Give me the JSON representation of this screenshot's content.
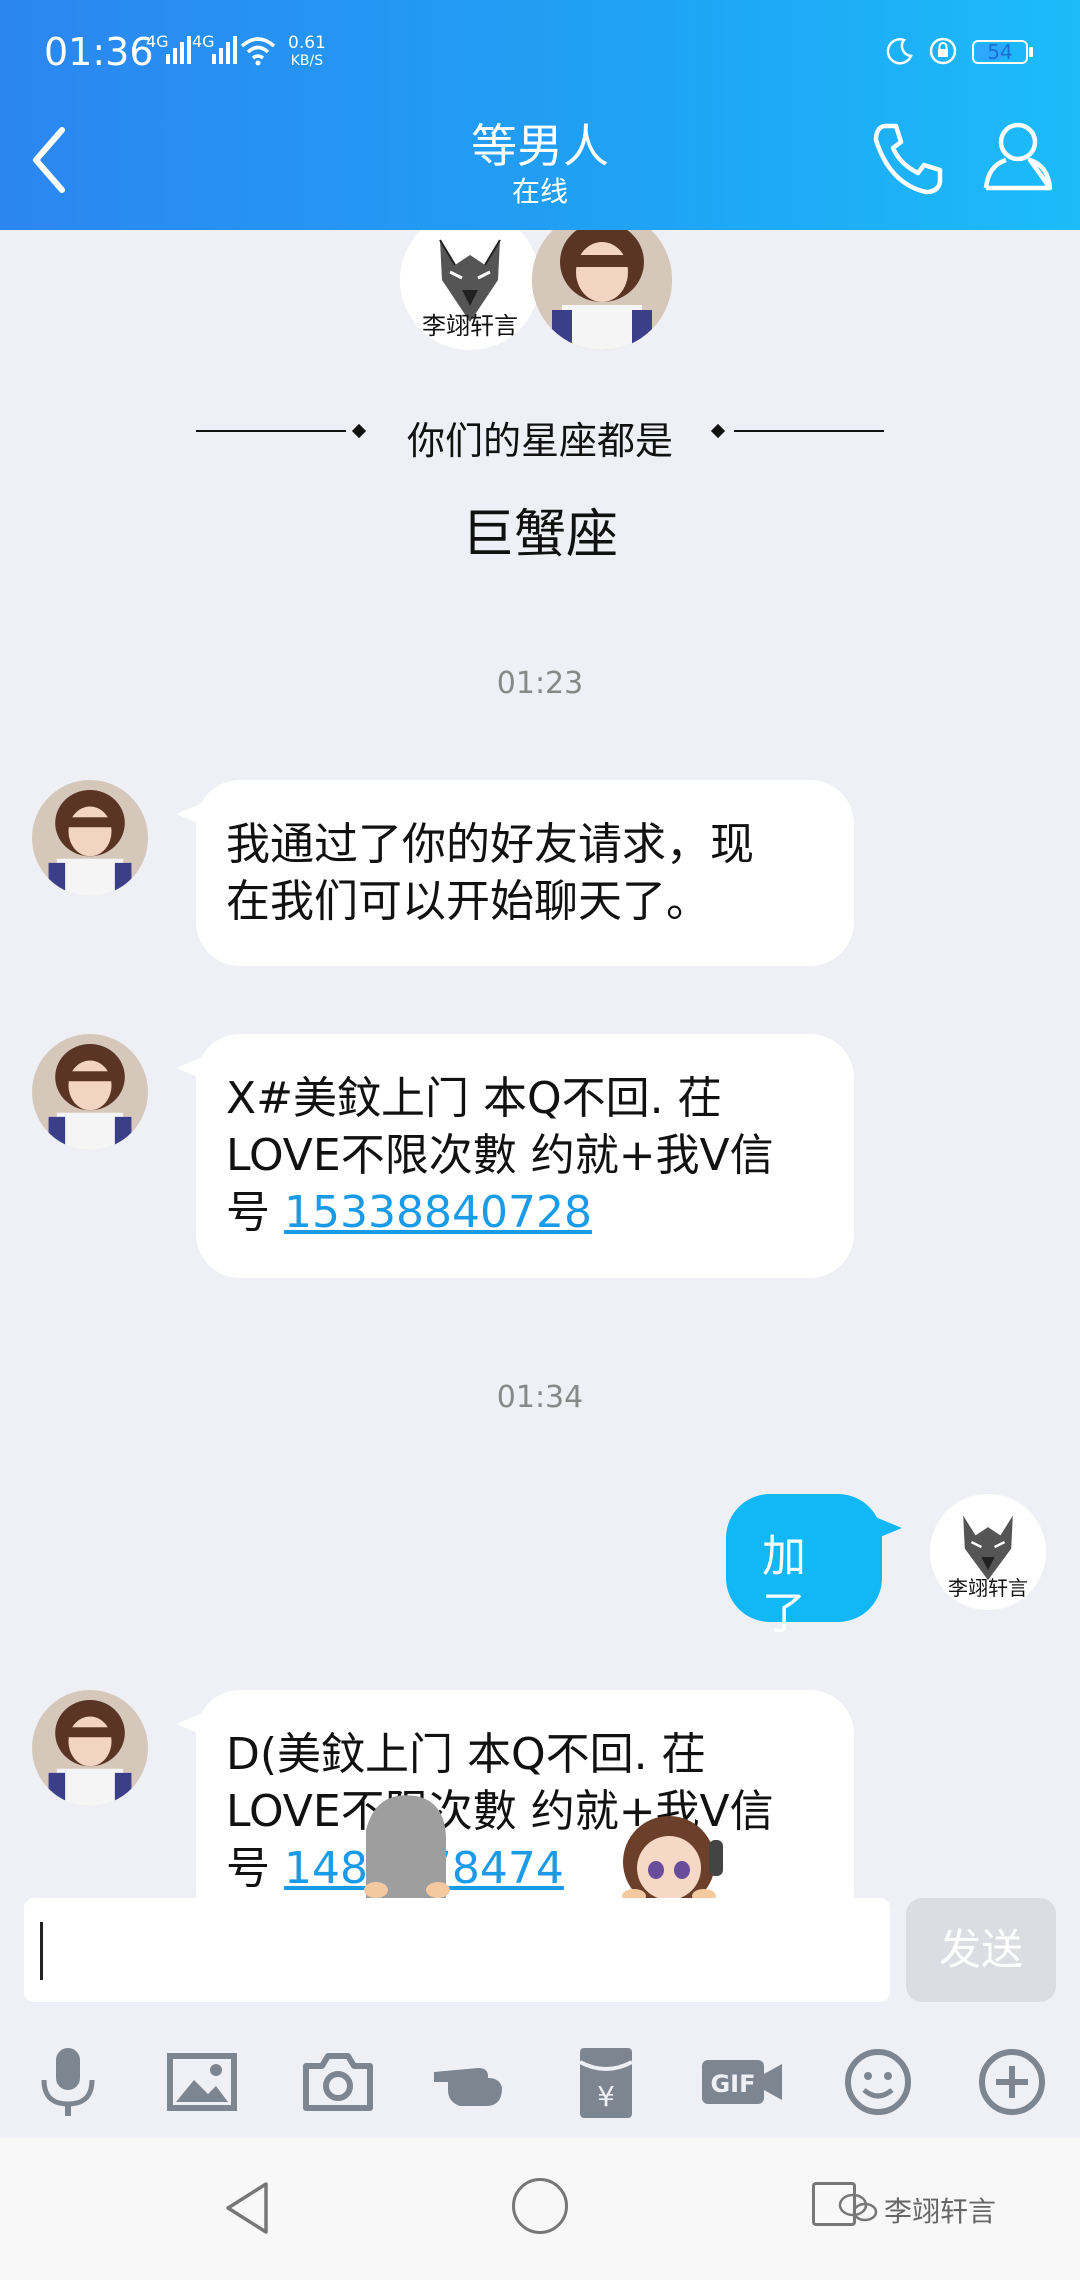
{
  "status_bar": {
    "time": "01:36",
    "network_labels": [
      "4G",
      "4G"
    ],
    "speed_value": "0.61",
    "speed_unit": "KB/S",
    "battery": "54"
  },
  "header": {
    "title": "等男人",
    "subtitle": "在线"
  },
  "intro": {
    "my_avatar_text": "李翊轩言",
    "zodiac_caption": "你们的星座都是",
    "zodiac_value": "巨蟹座"
  },
  "messages": [
    {
      "type": "time",
      "text": "01:23"
    },
    {
      "type": "received",
      "lines": [
        "我通过了你的好友请求，现",
        "在我们可以开始聊天了。"
      ]
    },
    {
      "type": "received",
      "lines": [
        "X#美鈫上门 本Q不回. 茌",
        "LOVE不限次數 约就+我V信"
      ],
      "last_prefix": "号 ",
      "phone": "15338840728"
    },
    {
      "type": "time",
      "text": "01:34"
    },
    {
      "type": "sent",
      "text": "加了"
    },
    {
      "type": "received",
      "lines": [
        "D(美鈫上门 本Q不回. 茌",
        "LOVE不限次數 约就+我V信"
      ],
      "last_prefix": "号 ",
      "phone": "148    78474"
    }
  ],
  "input": {
    "value": "",
    "send_label": "发送"
  },
  "toolbar_icons": [
    "microphone-icon",
    "image-icon",
    "camera-icon",
    "poke-hand-icon",
    "red-packet-icon",
    "gif-icon",
    "emoji-icon",
    "plus-icon"
  ],
  "watermark": "李翊轩言",
  "colors": {
    "header_gradient_start": "#2b86f0",
    "header_gradient_end": "#1cbcf8",
    "sent_bubble": "#12b7f5",
    "link": "#1a9be8",
    "background": "#eff0f5"
  }
}
